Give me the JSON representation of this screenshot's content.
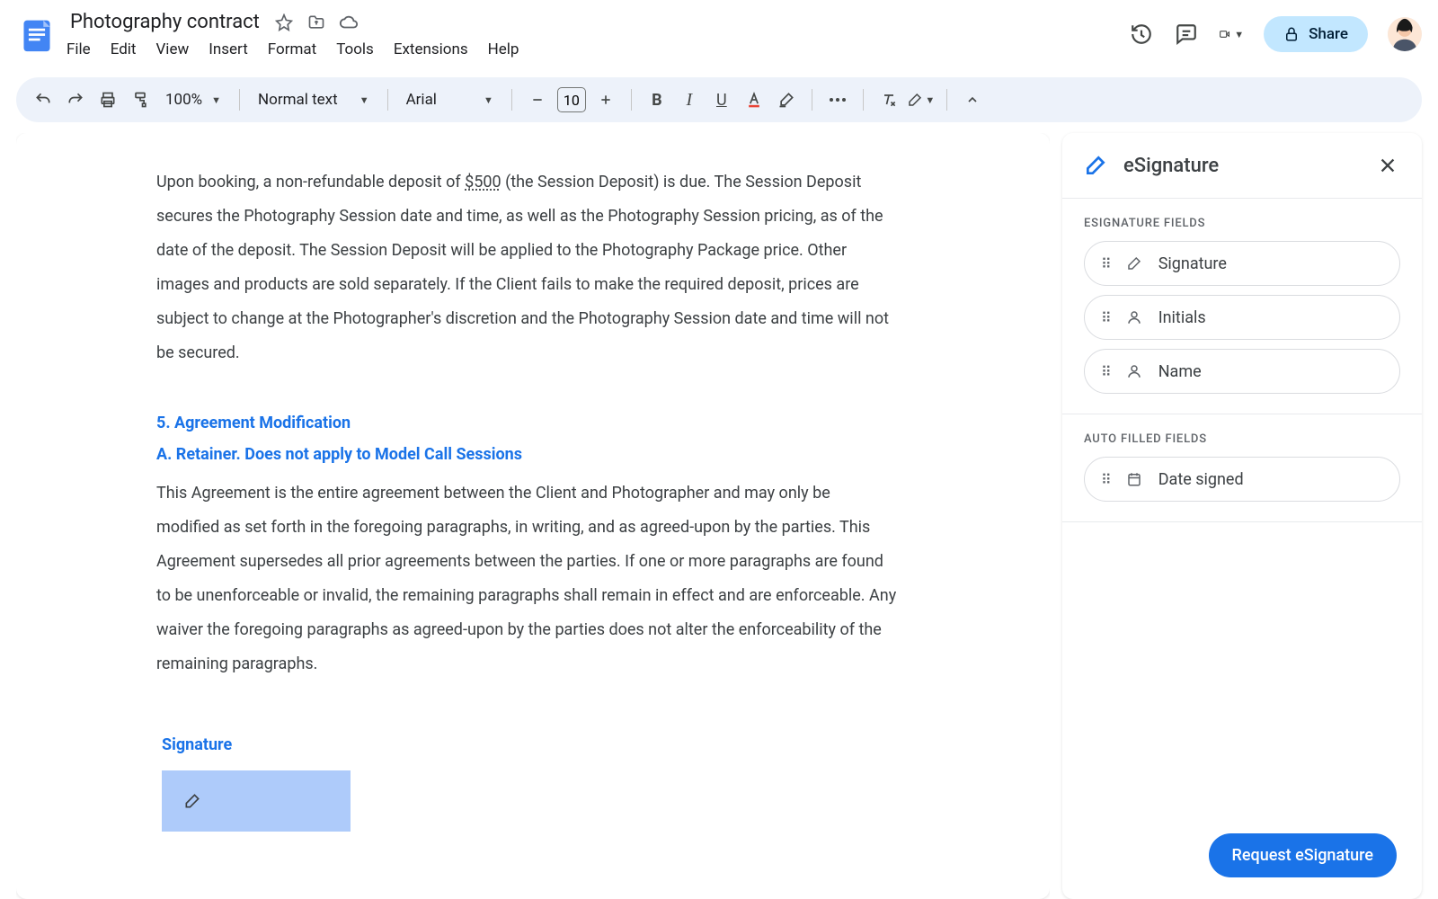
{
  "header": {
    "title": "Photography contract",
    "menus": [
      "File",
      "Edit",
      "View",
      "Insert",
      "Format",
      "Tools",
      "Extensions",
      "Help"
    ],
    "share_label": "Share"
  },
  "toolbar": {
    "zoom": "100%",
    "style": "Normal text",
    "font": "Arial",
    "font_size": "10"
  },
  "document": {
    "para1_pre": "Upon booking, a non-refundable deposit of ",
    "deposit_amount": "$500",
    "para1_post": " (the Session Deposit) is due. The Session Deposit secures the Photography Session date and time, as well as the Photography Session pricing, as of the date of the deposit. The Session Deposit will be applied to the Photography Package price. Other images and products are sold separately. If the Client fails to make the required deposit, prices are subject to change at the Photographer's discretion and the Photography Session date and time will not be secured.",
    "heading5": "5. Agreement Modification",
    "subheading_a": "A. Retainer.  Does not apply to Model Call Sessions",
    "para2": "This Agreement is the entire agreement between the Client and Photographer and may only be modified as set forth in the foregoing paragraphs, in writing, and as agreed-upon by the parties.  This Agreement supersedes all prior agreements between the parties. If one or more paragraphs are found to be unenforceable or invalid, the remaining paragraphs shall remain in effect and are enforceable. Any waiver the foregoing paragraphs as agreed-upon by the parties does not alter the enforceability of the remaining paragraphs.",
    "signature_label": "Signature"
  },
  "panel": {
    "title": "eSignature",
    "section1_label": "ESIGNATURE FIELDS",
    "fields": [
      {
        "label": "Signature",
        "icon": "signature"
      },
      {
        "label": "Initials",
        "icon": "person"
      },
      {
        "label": "Name",
        "icon": "person"
      }
    ],
    "section2_label": "AUTO FILLED FIELDS",
    "auto_fields": [
      {
        "label": "Date signed",
        "icon": "calendar"
      }
    ],
    "request_label": "Request eSignature"
  }
}
